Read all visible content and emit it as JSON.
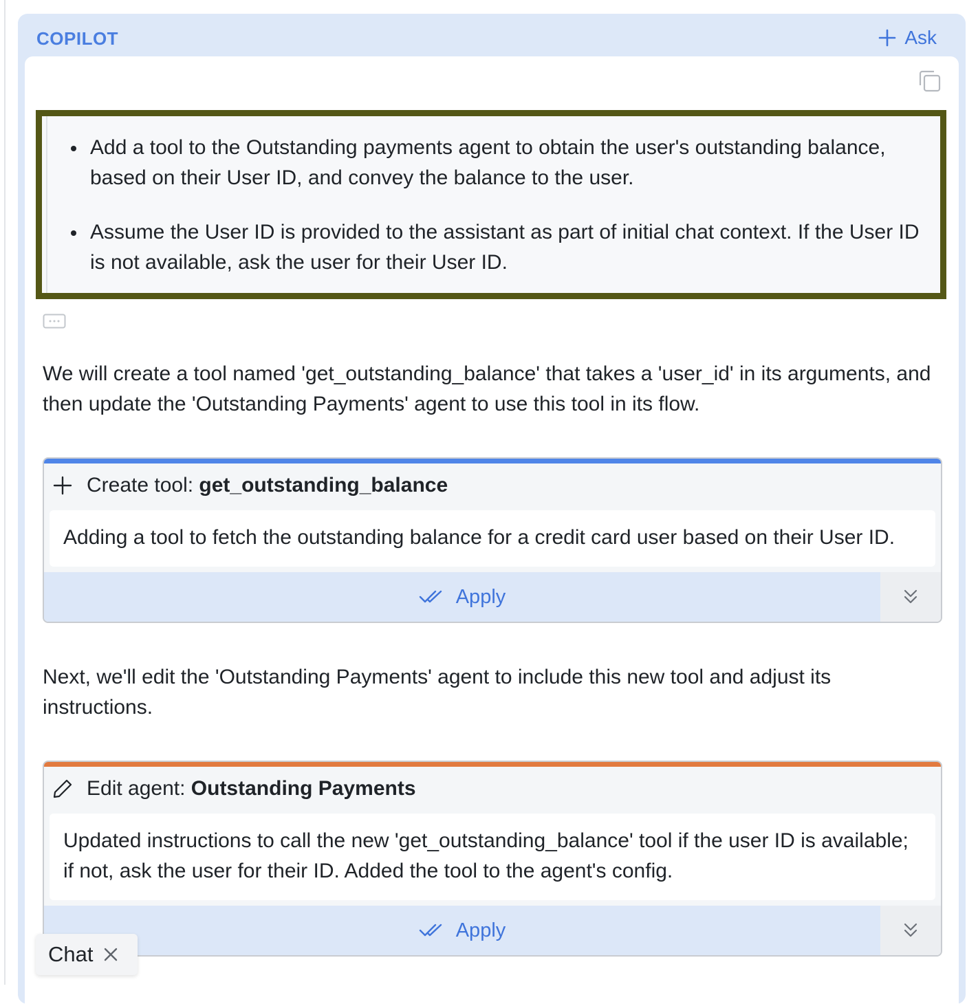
{
  "panel": {
    "title": "COPILOT",
    "ask_label": "Ask",
    "accent_color": "#3f74db"
  },
  "user_message": {
    "bullets": [
      "Add a tool to the Outstanding payments agent to obtain the user's outstanding balance, based on their User ID, and convey the balance to the user.",
      "Assume the User ID is provided to the assistant as part of initial chat context. If the User ID is not available, ask the user for their User ID."
    ],
    "highlight_color": "#545716"
  },
  "response": {
    "intro": "We will create a tool named 'get_outstanding_balance' that takes a 'user_id' in its arguments, and then update the 'Outstanding Payments' agent to use this tool in its flow.",
    "middle": "Next, we'll edit the 'Outstanding Payments' agent to include this new tool and adjust its instructions.",
    "cards": [
      {
        "action": "Create tool: ",
        "name": "get_outstanding_balance",
        "description": "Adding a tool to fetch the outstanding balance for a credit card user based on their User ID.",
        "apply_label": "Apply",
        "icon": "plus-icon",
        "accent": "#4f85e8"
      },
      {
        "action": "Edit agent: ",
        "name": "Outstanding Payments",
        "description": "Updated instructions to call the new 'get_outstanding_balance' tool if the user ID is available; if not, ask the user for their ID. Added the tool to the agent's config.",
        "apply_label": "Apply",
        "icon": "pencil-icon",
        "accent": "#e27a3f"
      }
    ]
  },
  "bottom_tab": {
    "label": "Chat"
  }
}
